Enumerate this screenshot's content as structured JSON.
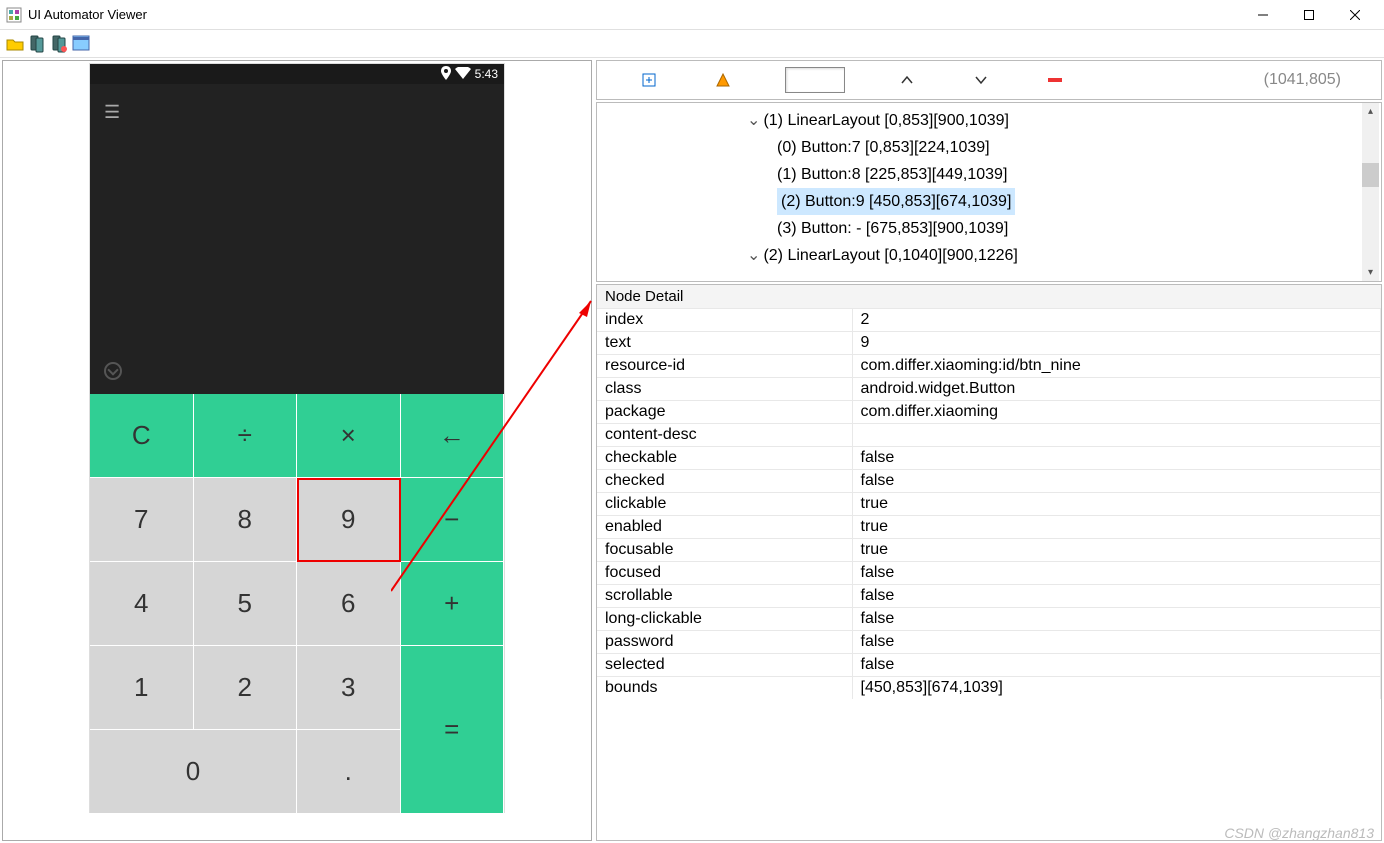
{
  "window": {
    "title": "UI Automator Viewer"
  },
  "statusbar": {
    "time": "5:43"
  },
  "keypad": {
    "r0": [
      "C",
      "÷",
      "×",
      "←"
    ],
    "r1": [
      "7",
      "8",
      "9",
      "−"
    ],
    "r2": [
      "4",
      "5",
      "6",
      "+"
    ],
    "r3": [
      "1",
      "2",
      "3",
      "="
    ],
    "r4": [
      "0",
      "."
    ]
  },
  "controls": {
    "coords": "(1041,805)"
  },
  "tree": [
    {
      "indent": 150,
      "caret": "⌄",
      "label": "(1) LinearLayout [0,853][900,1039]"
    },
    {
      "indent": 180,
      "caret": "",
      "label": "(0) Button:7 [0,853][224,1039]"
    },
    {
      "indent": 180,
      "caret": "",
      "label": "(1) Button:8 [225,853][449,1039]"
    },
    {
      "indent": 180,
      "caret": "",
      "label": "(2) Button:9 [450,853][674,1039]",
      "selected": true
    },
    {
      "indent": 180,
      "caret": "",
      "label": "(3) Button: -  [675,853][900,1039]"
    },
    {
      "indent": 150,
      "caret": "⌄",
      "label": "(2) LinearLayout [0,1040][900,1226]"
    }
  ],
  "detail": {
    "header": "Node Detail",
    "rows": [
      {
        "k": "index",
        "v": "2"
      },
      {
        "k": "text",
        "v": "9"
      },
      {
        "k": "resource-id",
        "v": "com.differ.xiaoming:id/btn_nine"
      },
      {
        "k": "class",
        "v": "android.widget.Button"
      },
      {
        "k": "package",
        "v": "com.differ.xiaoming"
      },
      {
        "k": "content-desc",
        "v": ""
      },
      {
        "k": "checkable",
        "v": "false"
      },
      {
        "k": "checked",
        "v": "false"
      },
      {
        "k": "clickable",
        "v": "true"
      },
      {
        "k": "enabled",
        "v": "true"
      },
      {
        "k": "focusable",
        "v": "true"
      },
      {
        "k": "focused",
        "v": "false"
      },
      {
        "k": "scrollable",
        "v": "false"
      },
      {
        "k": "long-clickable",
        "v": "false"
      },
      {
        "k": "password",
        "v": "false"
      },
      {
        "k": "selected",
        "v": "false"
      },
      {
        "k": "bounds",
        "v": "[450,853][674,1039]"
      }
    ]
  },
  "watermark": "CSDN @zhangzhan813"
}
